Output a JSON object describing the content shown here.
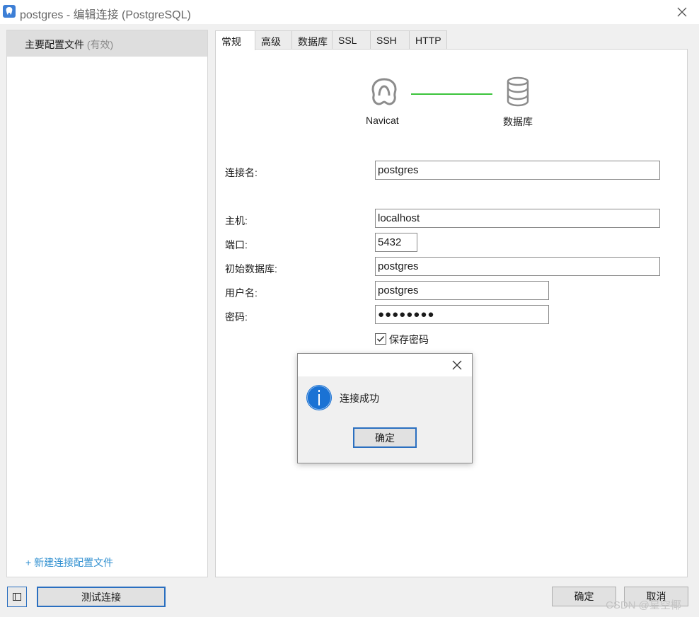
{
  "window": {
    "title": "postgres - 编辑连接 (PostgreSQL)"
  },
  "sidebar": {
    "profile_name": "主要配置文件",
    "profile_status": "(有效)",
    "new_profile_link": "+ 新建连接配置文件"
  },
  "tabs": [
    {
      "label": "常规",
      "active": true
    },
    {
      "label": "高级"
    },
    {
      "label": "数据库"
    },
    {
      "label": "SSL"
    },
    {
      "label": "SSH"
    },
    {
      "label": "HTTP"
    }
  ],
  "diagram": {
    "left_label": "Navicat",
    "right_label": "数据库",
    "line_color": "#3cc43c",
    "left_icon": "navicat-logo-icon",
    "right_icon": "database-icon"
  },
  "form": {
    "connection_name_label": "连接名:",
    "connection_name_value": "postgres",
    "host_label": "主机:",
    "host_value": "localhost",
    "port_label": "端口:",
    "port_value": "5432",
    "initial_db_label": "初始数据库:",
    "initial_db_value": "postgres",
    "username_label": "用户名:",
    "username_value": "postgres",
    "password_label": "密码:",
    "password_value": "●●●●●●●●",
    "save_password_label": "保存密码",
    "save_password_checked": true
  },
  "dialog": {
    "message": "连接成功",
    "ok_label": "确定",
    "icon": "info-icon",
    "icon_color": "#1a72d4"
  },
  "footer": {
    "test_connection_label": "测试连接",
    "ok_label": "确定",
    "cancel_label": "取消"
  },
  "watermark": "CSDN @星空椰"
}
